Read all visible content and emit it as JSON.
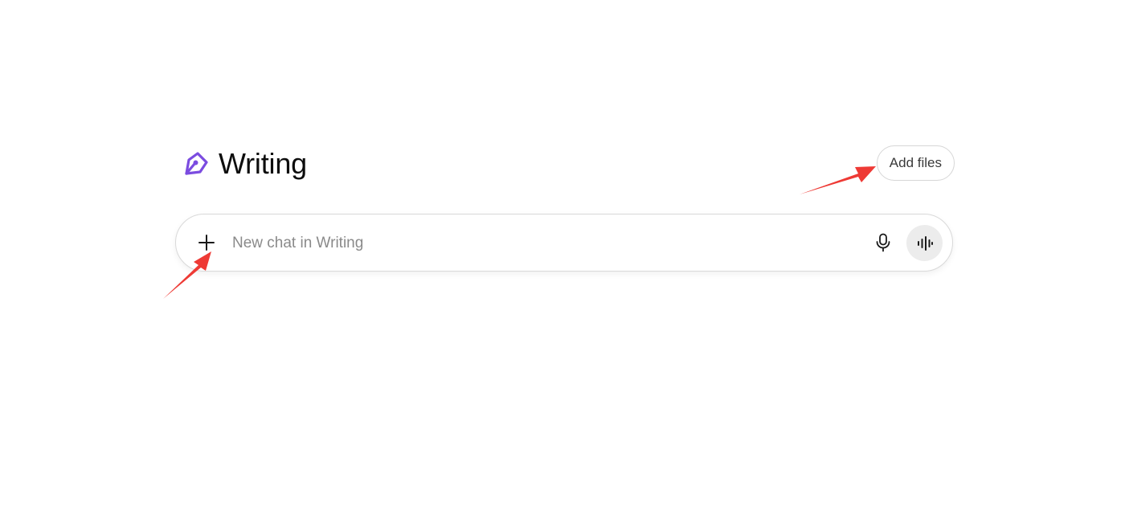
{
  "project": {
    "title": "Writing",
    "icon": "pen-nib-icon",
    "accent_color": "#7b4ce0"
  },
  "header": {
    "add_files_label": "Add files"
  },
  "composer": {
    "placeholder": "New chat in Writing",
    "plus_icon": "plus-icon",
    "mic_icon": "microphone-icon",
    "voice_icon": "voice-mode-icon"
  },
  "annotations": {
    "arrow_color": "#ee3a35"
  }
}
